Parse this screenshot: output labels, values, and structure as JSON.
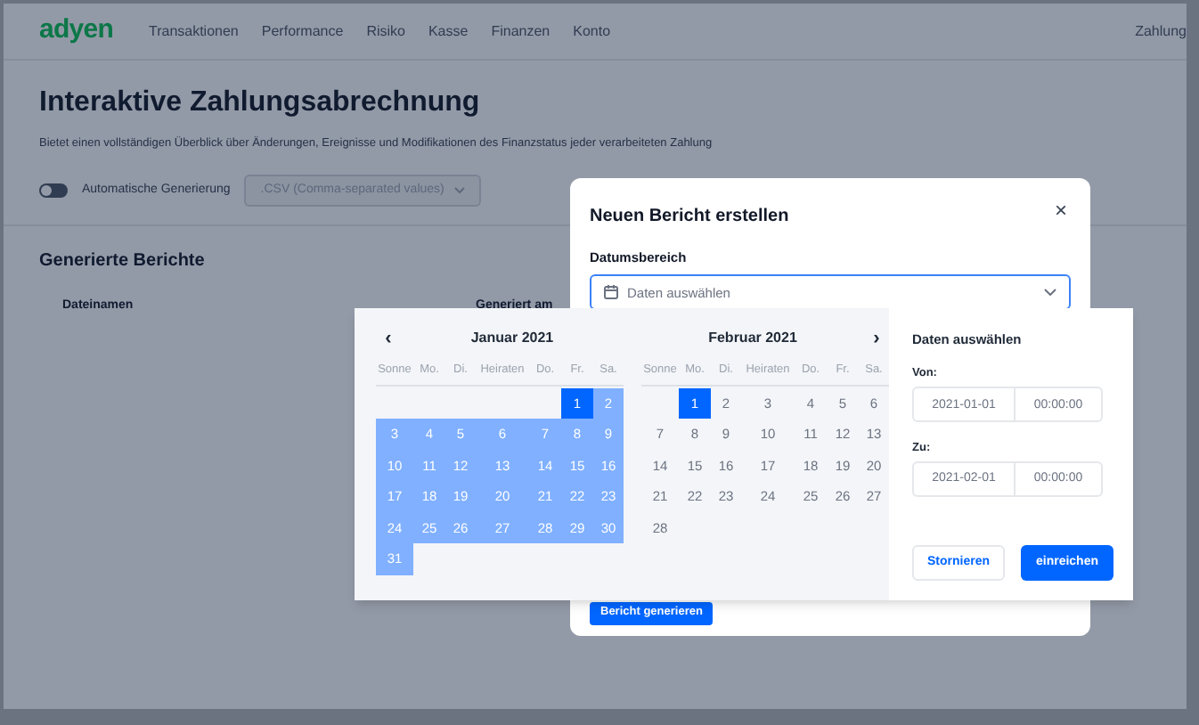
{
  "nav": {
    "logo": "adyen",
    "items": [
      {
        "label": "Transaktionen"
      },
      {
        "label": "Performance"
      },
      {
        "label": "Risiko"
      },
      {
        "label": "Kasse"
      },
      {
        "label": "Finanzen"
      },
      {
        "label": "Konto"
      }
    ],
    "right_link": "Zahlung"
  },
  "page": {
    "title": "Interaktive Zahlungsabrechnung",
    "subtitle": "Bietet einen vollständigen Überblick über Änderungen, Ereignisse und Modifikationen des Finanzstatus jeder verarbeiteten Zahlung",
    "auto_toggle": {
      "label": "Automatische Generierung",
      "on": false
    },
    "format_select": {
      "value": ".CSV (Comma-separated values)"
    },
    "section_title": "Generierte Berichte",
    "table": {
      "columns": [
        "Dateinamen",
        "Generiert am"
      ]
    }
  },
  "modal": {
    "title": "Neuen Bericht erstellen",
    "close": "×",
    "field_label": "Datumsbereich",
    "field": {
      "placeholder": "Daten auswählen"
    },
    "submit": "Bericht generieren"
  },
  "calendar": {
    "prev": "‹",
    "next": "›",
    "months": [
      {
        "title": "Januar 2021",
        "weekdays": [
          "Sonne",
          "Mo.",
          "Di.",
          "Heiraten",
          "Do.",
          "Fr.",
          "Sa."
        ],
        "weeks": [
          [
            {
              "kind": "blank"
            },
            {
              "kind": "blank"
            },
            {
              "kind": "blank"
            },
            {
              "kind": "blank"
            },
            {
              "kind": "blank"
            },
            {
              "kind": "day",
              "label": "1",
              "selected": true
            },
            {
              "kind": "day",
              "label": "2",
              "selected": false,
              "in_range": true
            }
          ],
          [
            {
              "kind": "day",
              "label": "3",
              "selected": false,
              "in_range": true
            },
            {
              "kind": "day",
              "label": "4",
              "selected": false,
              "in_range": true
            },
            {
              "kind": "day",
              "label": "5",
              "selected": false,
              "in_range": true
            },
            {
              "kind": "day",
              "label": "6",
              "selected": false,
              "in_range": true
            },
            {
              "kind": "day",
              "label": "7",
              "selected": false,
              "in_range": true
            },
            {
              "kind": "day",
              "label": "8",
              "selected": false,
              "in_range": true
            },
            {
              "kind": "day",
              "label": "9",
              "selected": false,
              "in_range": true
            }
          ],
          [
            {
              "kind": "day",
              "label": "10",
              "selected": false,
              "in_range": true
            },
            {
              "kind": "day",
              "label": "11",
              "selected": false,
              "in_range": true
            },
            {
              "kind": "day",
              "label": "12",
              "selected": false,
              "in_range": true
            },
            {
              "kind": "day",
              "label": "13",
              "selected": false,
              "in_range": true
            },
            {
              "kind": "day",
              "label": "14",
              "selected": false,
              "in_range": true
            },
            {
              "kind": "day",
              "label": "15",
              "selected": false,
              "in_range": true
            },
            {
              "kind": "day",
              "label": "16",
              "selected": false,
              "in_range": true
            }
          ],
          [
            {
              "kind": "day",
              "label": "17",
              "selected": false,
              "in_range": true
            },
            {
              "kind": "day",
              "label": "18",
              "selected": false,
              "in_range": true
            },
            {
              "kind": "day",
              "label": "19",
              "selected": false,
              "in_range": true
            },
            {
              "kind": "day",
              "label": "20",
              "selected": false,
              "in_range": true
            },
            {
              "kind": "day",
              "label": "21",
              "selected": false,
              "in_range": true
            },
            {
              "kind": "day",
              "label": "22",
              "selected": false,
              "in_range": true
            },
            {
              "kind": "day",
              "label": "23",
              "selected": false,
              "in_range": true
            }
          ],
          [
            {
              "kind": "day",
              "label": "24",
              "selected": false,
              "in_range": true
            },
            {
              "kind": "day",
              "label": "25",
              "selected": false,
              "in_range": true
            },
            {
              "kind": "day",
              "label": "26",
              "selected": false,
              "in_range": true
            },
            {
              "kind": "day",
              "label": "27",
              "selected": false,
              "in_range": true
            },
            {
              "kind": "day",
              "label": "28",
              "selected": false,
              "in_range": true
            },
            {
              "kind": "day",
              "label": "29",
              "selected": false,
              "in_range": true
            },
            {
              "kind": "day",
              "label": "30",
              "selected": false,
              "in_range": true
            }
          ],
          [
            {
              "kind": "day",
              "label": "31",
              "selected": false,
              "in_range": true
            }
          ]
        ]
      },
      {
        "title": "Februar 2021",
        "weekdays": [
          "Sonne",
          "Mo.",
          "Di.",
          "Heiraten",
          "Do.",
          "Fr.",
          "Sa."
        ],
        "weeks": [
          [
            {
              "kind": "blank"
            },
            {
              "kind": "day",
              "label": "1",
              "selected": true
            },
            {
              "kind": "day",
              "label": "2",
              "selected": false,
              "in_range": false
            },
            {
              "kind": "day",
              "label": "3",
              "selected": false,
              "in_range": false
            },
            {
              "kind": "day",
              "label": "4",
              "selected": false,
              "in_range": false
            },
            {
              "kind": "day",
              "label": "5",
              "selected": false,
              "in_range": false
            },
            {
              "kind": "day",
              "label": "6",
              "selected": false,
              "in_range": false
            }
          ],
          [
            {
              "kind": "day",
              "label": "7",
              "selected": false,
              "in_range": false
            },
            {
              "kind": "day",
              "label": "8",
              "selected": false,
              "in_range": false
            },
            {
              "kind": "day",
              "label": "9",
              "selected": false,
              "in_range": false
            },
            {
              "kind": "day",
              "label": "10",
              "selected": false,
              "in_range": false
            },
            {
              "kind": "day",
              "label": "11",
              "selected": false,
              "in_range": false
            },
            {
              "kind": "day",
              "label": "12",
              "selected": false,
              "in_range": false
            },
            {
              "kind": "day",
              "label": "13",
              "selected": false,
              "in_range": false
            }
          ],
          [
            {
              "kind": "day",
              "label": "14",
              "selected": false,
              "in_range": false
            },
            {
              "kind": "day",
              "label": "15",
              "selected": false,
              "in_range": false
            },
            {
              "kind": "day",
              "label": "16",
              "selected": false,
              "in_range": false
            },
            {
              "kind": "day",
              "label": "17",
              "selected": false,
              "in_range": false
            },
            {
              "kind": "day",
              "label": "18",
              "selected": false,
              "in_range": false
            },
            {
              "kind": "day",
              "label": "19",
              "selected": false,
              "in_range": false
            },
            {
              "kind": "day",
              "label": "20",
              "selected": false,
              "in_range": false
            }
          ],
          [
            {
              "kind": "day",
              "label": "21",
              "selected": false,
              "in_range": false
            },
            {
              "kind": "day",
              "label": "22",
              "selected": false,
              "in_range": false
            },
            {
              "kind": "day",
              "label": "23",
              "selected": false,
              "in_range": false
            },
            {
              "kind": "day",
              "label": "24",
              "selected": false,
              "in_range": false
            },
            {
              "kind": "day",
              "label": "25",
              "selected": false,
              "in_range": false
            },
            {
              "kind": "day",
              "label": "26",
              "selected": false,
              "in_range": false
            },
            {
              "kind": "day",
              "label": "27",
              "selected": false,
              "in_range": false
            }
          ],
          [
            {
              "kind": "day",
              "label": "28",
              "selected": false,
              "in_range": false
            }
          ]
        ]
      }
    ],
    "panel": {
      "title": "Daten auswählen",
      "from_label": "Von:",
      "from_date": "2021-01-01",
      "from_time": "00:00:00",
      "to_label": "Zu:",
      "to_date": "2021-02-01",
      "to_time": "00:00:00",
      "cancel": "Stornieren",
      "submit": "einreichen"
    }
  }
}
